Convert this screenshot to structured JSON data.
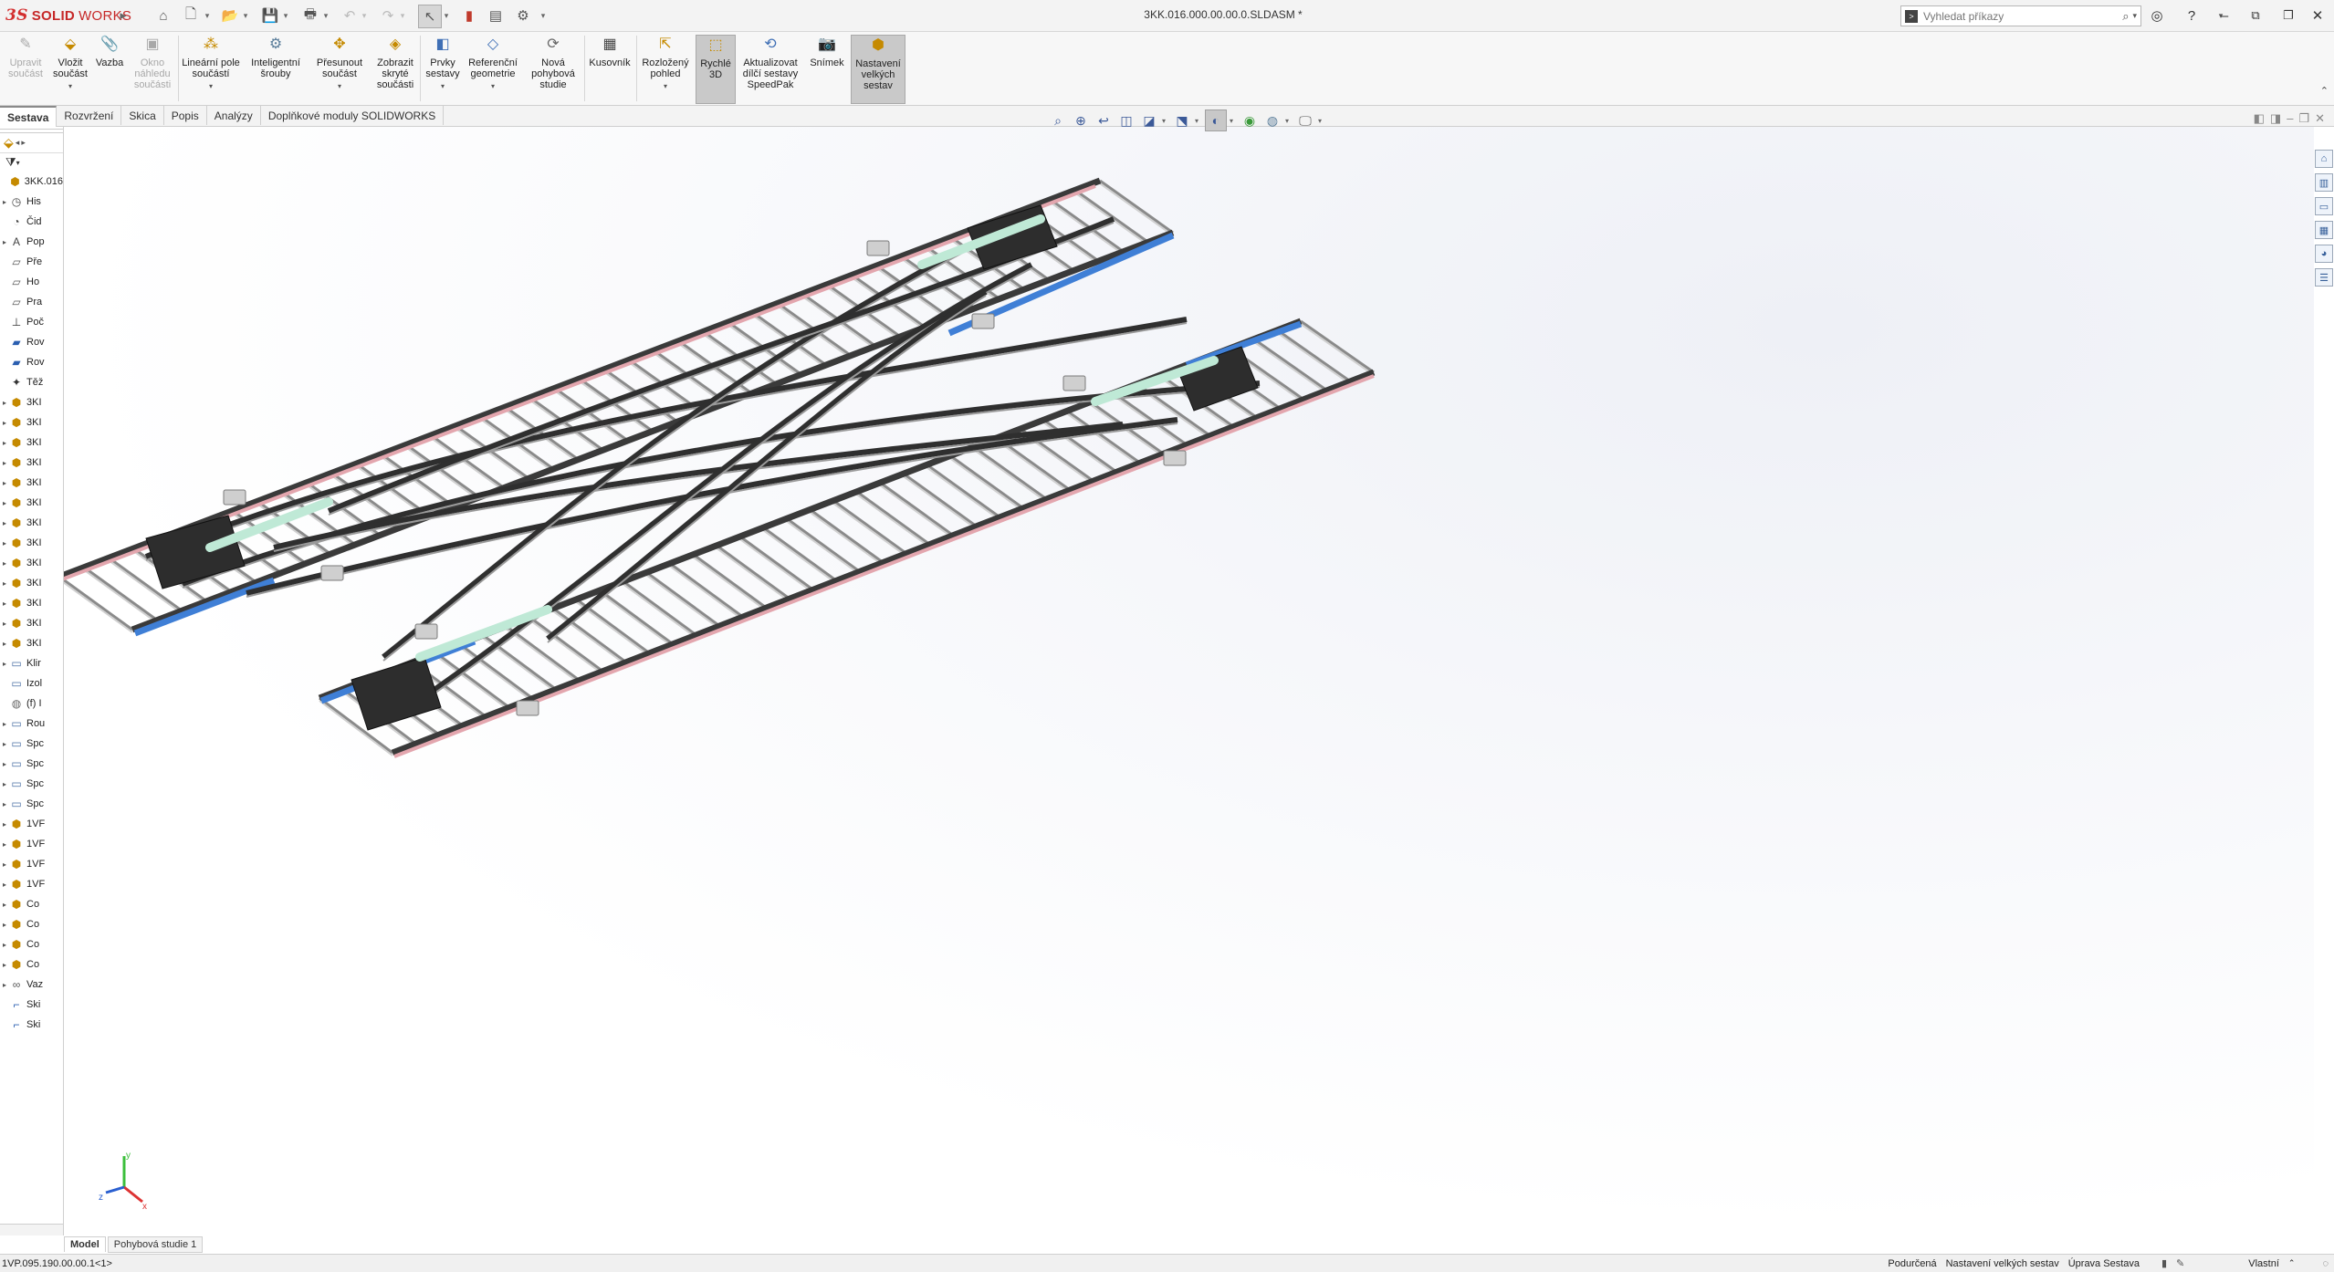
{
  "app": {
    "logo_ds": "3S",
    "logo_solid": "SOLID",
    "logo_works": "WORKS",
    "document_title": "3KK.016.000.00.00.0.SLDASM *"
  },
  "search": {
    "placeholder": "Vyhledat příkazy"
  },
  "ribbon": [
    {
      "label": "Upravit součást",
      "disabled": true
    },
    {
      "label": "Vložit součást",
      "dropdown": true
    },
    {
      "label": "Vazba"
    },
    {
      "label": "Okno náhledu součásti",
      "disabled": true
    },
    {
      "label": "Lineární pole součástí",
      "dropdown": true
    },
    {
      "label": "Inteligentní šrouby"
    },
    {
      "label": "Přesunout součást",
      "dropdown": true
    },
    {
      "label": "Zobrazit skryté součásti"
    },
    {
      "label": "Prvky sestavy",
      "dropdown": true
    },
    {
      "label": "Referenční geometrie",
      "dropdown": true
    },
    {
      "label": "Nová pohybová studie"
    },
    {
      "label": "Kusovník"
    },
    {
      "label": "Rozložený pohled",
      "dropdown": true
    },
    {
      "label": "Rychlé 3D",
      "active": true
    },
    {
      "label": "Aktualizovat dílčí sestavy SpeedPak"
    },
    {
      "label": "Snímek"
    },
    {
      "label": "Nastavení velkých sestav",
      "active": true
    }
  ],
  "tabs": [
    "Sestava",
    "Rozvržení",
    "Skica",
    "Popis",
    "Analýzy",
    "Doplňkové moduly SOLIDWORKS"
  ],
  "tree": [
    {
      "label": "3KK.016",
      "icon": "assembly-icon",
      "exp": ""
    },
    {
      "label": "His",
      "icon": "history-icon",
      "exp": "▸"
    },
    {
      "label": "Čid",
      "icon": "sensor-icon",
      "exp": ""
    },
    {
      "label": "Pop",
      "icon": "annotations-icon",
      "exp": "▸"
    },
    {
      "label": "Pře",
      "icon": "plane-icon",
      "exp": ""
    },
    {
      "label": "Ho",
      "icon": "plane-icon",
      "exp": ""
    },
    {
      "label": "Pra",
      "icon": "plane-icon",
      "exp": ""
    },
    {
      "label": "Poč",
      "icon": "origin-icon",
      "exp": ""
    },
    {
      "label": "Rov",
      "icon": "plane-blue-icon",
      "exp": ""
    },
    {
      "label": "Rov",
      "icon": "plane-blue-icon",
      "exp": ""
    },
    {
      "label": "Těž",
      "icon": "center-of-mass-icon",
      "exp": ""
    },
    {
      "label": "3KI",
      "icon": "subassembly-icon",
      "exp": "▸"
    },
    {
      "label": "3KI",
      "icon": "subassembly-icon",
      "exp": "▸"
    },
    {
      "label": "3KI",
      "icon": "subassembly-icon",
      "exp": "▸"
    },
    {
      "label": "3KI",
      "icon": "subassembly-icon",
      "exp": "▸"
    },
    {
      "label": "3KI",
      "icon": "subassembly-icon",
      "exp": "▸"
    },
    {
      "label": "3KI",
      "icon": "subassembly-icon",
      "exp": "▸"
    },
    {
      "label": "3KI",
      "icon": "subassembly-icon",
      "exp": "▸"
    },
    {
      "label": "3KI",
      "icon": "subassembly-icon",
      "exp": "▸"
    },
    {
      "label": "3KI",
      "icon": "subassembly-icon",
      "exp": "▸"
    },
    {
      "label": "3KI",
      "icon": "subassembly-icon",
      "exp": "▸"
    },
    {
      "label": "3KI",
      "icon": "subassembly-icon",
      "exp": "▸"
    },
    {
      "label": "3KI",
      "icon": "subassembly-icon",
      "exp": "▸"
    },
    {
      "label": "3KI",
      "icon": "subassembly-icon",
      "exp": "▸"
    },
    {
      "label": "Klir",
      "icon": "folder-icon",
      "exp": "▸"
    },
    {
      "label": "Izol",
      "icon": "folder-icon",
      "exp": ""
    },
    {
      "label": "(f) I",
      "icon": "part-icon",
      "exp": ""
    },
    {
      "label": "Rou",
      "icon": "folder-icon",
      "exp": "▸"
    },
    {
      "label": "Spc",
      "icon": "folder-icon",
      "exp": "▸"
    },
    {
      "label": "Spc",
      "icon": "folder-icon",
      "exp": "▸"
    },
    {
      "label": "Spc",
      "icon": "folder-icon",
      "exp": "▸"
    },
    {
      "label": "Spc",
      "icon": "folder-icon",
      "exp": "▸"
    },
    {
      "label": "1VF",
      "icon": "subassembly-icon",
      "exp": "▸"
    },
    {
      "label": "1VF",
      "icon": "subassembly-icon",
      "exp": "▸"
    },
    {
      "label": "1VF",
      "icon": "subassembly-icon",
      "exp": "▸"
    },
    {
      "label": "1VF",
      "icon": "subassembly-icon",
      "exp": "▸"
    },
    {
      "label": "Co",
      "icon": "subassembly-icon",
      "exp": "▸"
    },
    {
      "label": "Co",
      "icon": "subassembly-icon",
      "exp": "▸"
    },
    {
      "label": "Co",
      "icon": "subassembly-icon",
      "exp": "▸"
    },
    {
      "label": "Co",
      "icon": "subassembly-icon",
      "exp": "▸"
    },
    {
      "label": "Vaz",
      "icon": "mates-icon",
      "exp": "▸"
    },
    {
      "label": "Ski",
      "icon": "sketch-icon",
      "exp": ""
    },
    {
      "label": "Ski",
      "icon": "sketch-icon",
      "exp": ""
    }
  ],
  "bottom_tabs": [
    "Model",
    "Pohybová studie 1"
  ],
  "status": {
    "left": "1VP.095.190.00.00.1<1>",
    "state": "Podurčená",
    "mode": "Nastavení velkých sestav",
    "editing": "Úprava Sestava",
    "units": "Vlastní"
  },
  "colors": {
    "rail_steel": "#3a3a3a",
    "rail_blue": "#3f7fd6",
    "rail_pink": "#e3a6ae",
    "pad_green": "#bfe9d6",
    "accent_red": "#c62828"
  }
}
